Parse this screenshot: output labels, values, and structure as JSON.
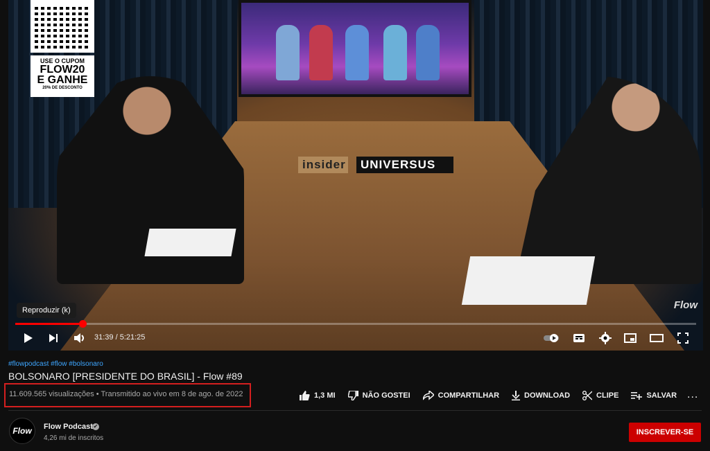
{
  "video": {
    "promo_line1": "USE O CUPOM",
    "promo_line2": "FLOW20",
    "promo_line3": "E GANHE",
    "promo_line4": "20% DE DESCONTO",
    "brand_left": "insider",
    "brand_right": "UNIVERSUS",
    "watermark": "Flow"
  },
  "player": {
    "tooltip": "Reproduzir (k)",
    "timecode": "31:39 / 5:21:25",
    "progress_fraction": 0.0985,
    "accent_color": "#ff0000"
  },
  "details": {
    "hashtags": "#flowpodcast #flow #bolsonaro",
    "title": "BOLSONARO [PRESIDENTE DO BRASIL] - Flow #89",
    "views_line": "11.609.565 visualizações • Transmitido ao vivo em 8 de ago. de 2022"
  },
  "actions": {
    "like": "1,3 MI",
    "dislike": "NÃO GOSTEI",
    "share": "COMPARTILHAR",
    "download": "DOWNLOAD",
    "clip": "CLIPE",
    "save": "SALVAR",
    "more": "..."
  },
  "channel": {
    "avatar_text": "Flow",
    "name": "Flow Podcast",
    "verified_mark": "✔",
    "subscribers": "4,26 mi de inscritos",
    "subscribe_label": "INSCREVER-SE"
  }
}
